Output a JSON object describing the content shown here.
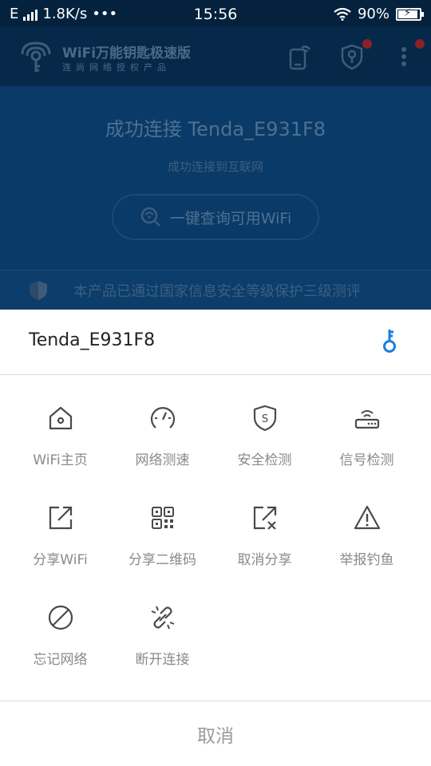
{
  "status_bar": {
    "network": "E",
    "speed": "1.8K/s",
    "dots": "•••",
    "time": "15:56",
    "battery": "90%"
  },
  "app": {
    "brand_title": "WiFi万能钥匙极速版",
    "brand_subtitle": "连尚网络授权产品",
    "connected_title": "成功连接 Tenda_E931F8",
    "connected_subtitle": "成功连接到互联网",
    "query_button": "一键查询可用WiFi",
    "certification": "本产品已通过国家信息安全等级保护三级测评"
  },
  "sheet": {
    "ssid": "Tenda_E931F8",
    "actions": [
      {
        "label": "WiFi主页",
        "icon": "home-icon"
      },
      {
        "label": "网络测速",
        "icon": "speedometer-icon"
      },
      {
        "label": "安全检测",
        "icon": "shield-s-icon"
      },
      {
        "label": "信号检测",
        "icon": "router-icon"
      },
      {
        "label": "分享WiFi",
        "icon": "share-icon"
      },
      {
        "label": "分享二维码",
        "icon": "qrcode-icon"
      },
      {
        "label": "取消分享",
        "icon": "cancel-share-icon"
      },
      {
        "label": "举报钓鱼",
        "icon": "warning-icon"
      },
      {
        "label": "忘记网络",
        "icon": "forget-icon"
      },
      {
        "label": "断开连接",
        "icon": "disconnect-icon"
      }
    ],
    "cancel": "取消"
  },
  "colors": {
    "accent_blue": "#1a7fe0",
    "icon_gray": "#4a4a4a",
    "label_gray": "#8a8a8a"
  }
}
